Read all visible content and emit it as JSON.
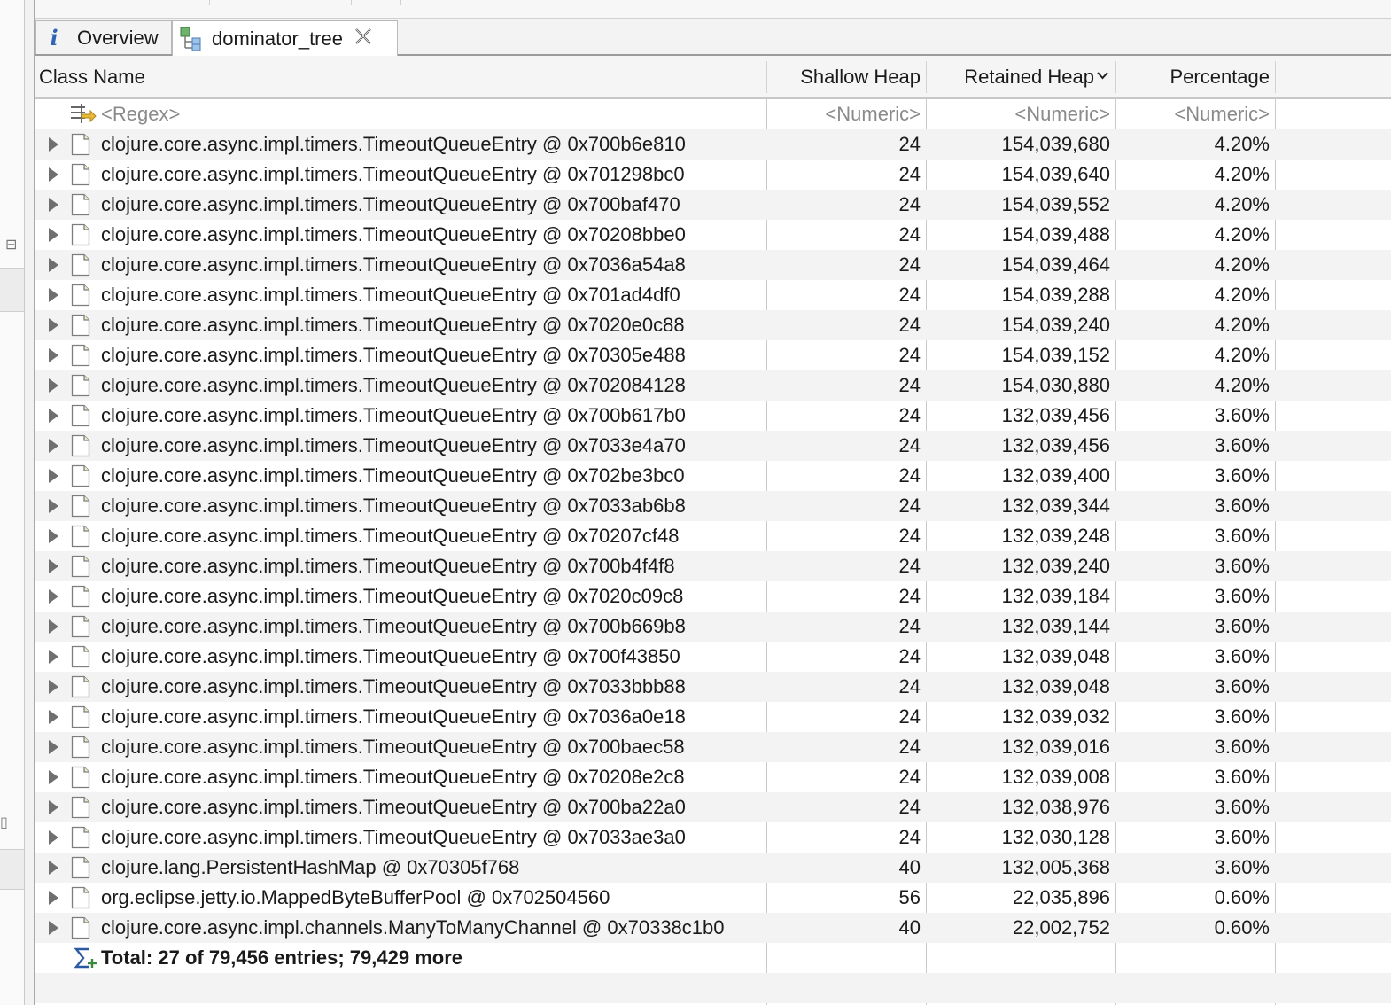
{
  "tabs": [
    {
      "label": "Overview",
      "icon": "info-icon"
    },
    {
      "label": "dominator_tree",
      "icon": "dominator-tree-icon",
      "closable": true
    }
  ],
  "columns": {
    "class_name": "Class Name",
    "shallow_heap": "Shallow Heap",
    "retained_heap": "Retained Heap",
    "percentage": "Percentage",
    "sorted_by": "Retained Heap",
    "sort_direction": "descending"
  },
  "filter_row": {
    "class_name": "<Regex>",
    "shallow_heap": "<Numeric>",
    "retained_heap": "<Numeric>",
    "percentage": "<Numeric>"
  },
  "rows": [
    {
      "name": "clojure.core.async.impl.timers.TimeoutQueueEntry @ 0x700b6e810",
      "shallow": "24",
      "retained": "154,039,680",
      "pct": "4.20%"
    },
    {
      "name": "clojure.core.async.impl.timers.TimeoutQueueEntry @ 0x701298bc0",
      "shallow": "24",
      "retained": "154,039,640",
      "pct": "4.20%"
    },
    {
      "name": "clojure.core.async.impl.timers.TimeoutQueueEntry @ 0x700baf470",
      "shallow": "24",
      "retained": "154,039,552",
      "pct": "4.20%"
    },
    {
      "name": "clojure.core.async.impl.timers.TimeoutQueueEntry @ 0x70208bbe0",
      "shallow": "24",
      "retained": "154,039,488",
      "pct": "4.20%"
    },
    {
      "name": "clojure.core.async.impl.timers.TimeoutQueueEntry @ 0x7036a54a8",
      "shallow": "24",
      "retained": "154,039,464",
      "pct": "4.20%"
    },
    {
      "name": "clojure.core.async.impl.timers.TimeoutQueueEntry @ 0x701ad4df0",
      "shallow": "24",
      "retained": "154,039,288",
      "pct": "4.20%"
    },
    {
      "name": "clojure.core.async.impl.timers.TimeoutQueueEntry @ 0x7020e0c88",
      "shallow": "24",
      "retained": "154,039,240",
      "pct": "4.20%"
    },
    {
      "name": "clojure.core.async.impl.timers.TimeoutQueueEntry @ 0x70305e488",
      "shallow": "24",
      "retained": "154,039,152",
      "pct": "4.20%"
    },
    {
      "name": "clojure.core.async.impl.timers.TimeoutQueueEntry @ 0x702084128",
      "shallow": "24",
      "retained": "154,030,880",
      "pct": "4.20%"
    },
    {
      "name": "clojure.core.async.impl.timers.TimeoutQueueEntry @ 0x700b617b0",
      "shallow": "24",
      "retained": "132,039,456",
      "pct": "3.60%"
    },
    {
      "name": "clojure.core.async.impl.timers.TimeoutQueueEntry @ 0x7033e4a70",
      "shallow": "24",
      "retained": "132,039,456",
      "pct": "3.60%"
    },
    {
      "name": "clojure.core.async.impl.timers.TimeoutQueueEntry @ 0x702be3bc0",
      "shallow": "24",
      "retained": "132,039,400",
      "pct": "3.60%"
    },
    {
      "name": "clojure.core.async.impl.timers.TimeoutQueueEntry @ 0x7033ab6b8",
      "shallow": "24",
      "retained": "132,039,344",
      "pct": "3.60%"
    },
    {
      "name": "clojure.core.async.impl.timers.TimeoutQueueEntry @ 0x70207cf48",
      "shallow": "24",
      "retained": "132,039,248",
      "pct": "3.60%"
    },
    {
      "name": "clojure.core.async.impl.timers.TimeoutQueueEntry @ 0x700b4f4f8",
      "shallow": "24",
      "retained": "132,039,240",
      "pct": "3.60%"
    },
    {
      "name": "clojure.core.async.impl.timers.TimeoutQueueEntry @ 0x7020c09c8",
      "shallow": "24",
      "retained": "132,039,184",
      "pct": "3.60%"
    },
    {
      "name": "clojure.core.async.impl.timers.TimeoutQueueEntry @ 0x700b669b8",
      "shallow": "24",
      "retained": "132,039,144",
      "pct": "3.60%"
    },
    {
      "name": "clojure.core.async.impl.timers.TimeoutQueueEntry @ 0x700f43850",
      "shallow": "24",
      "retained": "132,039,048",
      "pct": "3.60%"
    },
    {
      "name": "clojure.core.async.impl.timers.TimeoutQueueEntry @ 0x7033bbb88",
      "shallow": "24",
      "retained": "132,039,048",
      "pct": "3.60%"
    },
    {
      "name": "clojure.core.async.impl.timers.TimeoutQueueEntry @ 0x7036a0e18",
      "shallow": "24",
      "retained": "132,039,032",
      "pct": "3.60%"
    },
    {
      "name": "clojure.core.async.impl.timers.TimeoutQueueEntry @ 0x700baec58",
      "shallow": "24",
      "retained": "132,039,016",
      "pct": "3.60%"
    },
    {
      "name": "clojure.core.async.impl.timers.TimeoutQueueEntry @ 0x70208e2c8",
      "shallow": "24",
      "retained": "132,039,008",
      "pct": "3.60%"
    },
    {
      "name": "clojure.core.async.impl.timers.TimeoutQueueEntry @ 0x700ba22a0",
      "shallow": "24",
      "retained": "132,038,976",
      "pct": "3.60%"
    },
    {
      "name": "clojure.core.async.impl.timers.TimeoutQueueEntry @ 0x7033ae3a0",
      "shallow": "24",
      "retained": "132,030,128",
      "pct": "3.60%"
    },
    {
      "name": "clojure.lang.PersistentHashMap @ 0x70305f768",
      "shallow": "40",
      "retained": "132,005,368",
      "pct": "3.60%"
    },
    {
      "name": "org.eclipse.jetty.io.MappedByteBufferPool @ 0x702504560",
      "shallow": "56",
      "retained": "22,035,896",
      "pct": "0.60%"
    },
    {
      "name": "clojure.core.async.impl.channels.ManyToManyChannel @ 0x70338c1b0",
      "shallow": "40",
      "retained": "22,002,752",
      "pct": "0.60%"
    }
  ],
  "total": {
    "label": "Total: 27 of 79,456 entries; 79,429 more",
    "icon": "sum-icon"
  },
  "colors": {
    "alt_row": "#f3f3f3",
    "info_icon": "#2f63b5",
    "header_bg": "#f5f5f5"
  }
}
